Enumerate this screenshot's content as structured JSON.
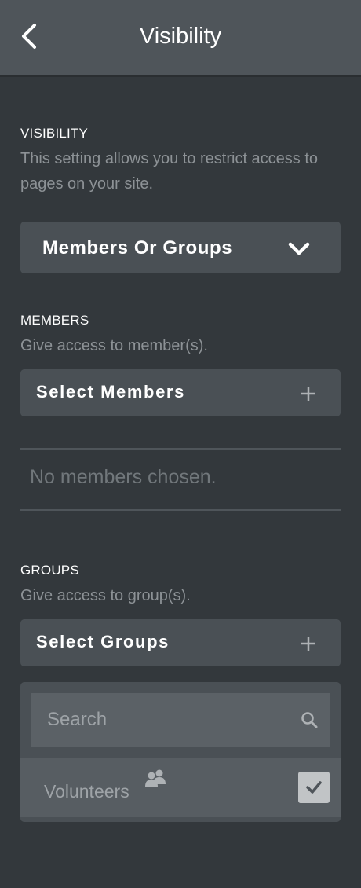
{
  "header": {
    "title": "Visibility",
    "back_icon": "chevron-left-icon"
  },
  "visibility": {
    "title": "VISIBILITY",
    "description": "This setting allows you to restrict access to pages on your site.",
    "selected_option": "Members Or Groups",
    "chevron_icon": "chevron-down-icon"
  },
  "members": {
    "title": "MEMBERS",
    "description": "Give access to member(s).",
    "select_label": "Select Members",
    "empty_text": "No members chosen."
  },
  "groups": {
    "title": "GROUPS",
    "description": "Give access to group(s).",
    "select_label": "Select Groups",
    "search_placeholder": "Search",
    "search_value": "",
    "items": [
      {
        "name": "Volunteers",
        "icon": "group-icon",
        "checked": true
      }
    ]
  },
  "colors": {
    "background": "#33383c",
    "header": "#4f555a",
    "control": "#4a5055",
    "muted_text": "#8d9296"
  }
}
